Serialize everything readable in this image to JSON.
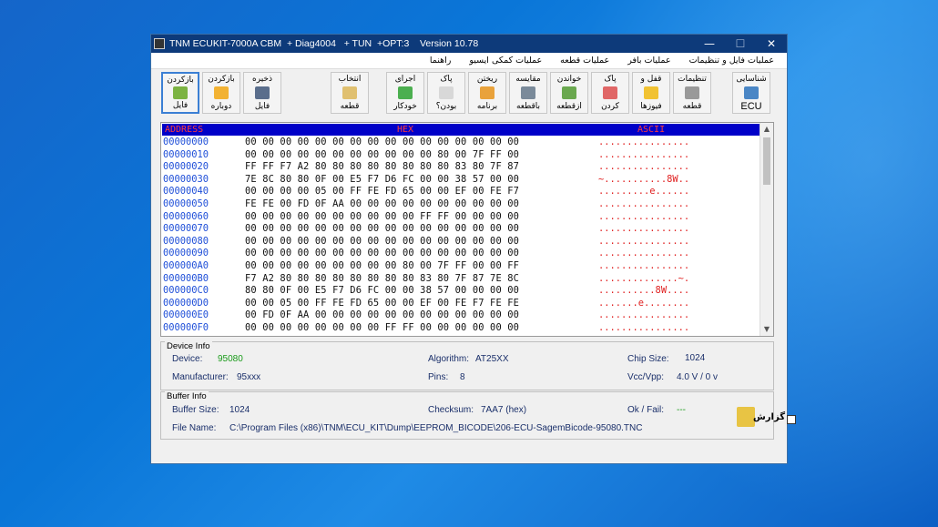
{
  "window": {
    "title": "TNM ECUKIT-7000A CBM  + Diag4004   + TUN  +OPT:3    Version 10.78",
    "controls": {
      "minimize": "—",
      "maximize": "☐",
      "close": "✕"
    }
  },
  "menu": [
    "عملیات فایل و تنظیمات",
    "عملیات بافر",
    "عملیات قطعه",
    "عملیات کمکی ایسیو",
    "راهنما"
  ],
  "toolbar": {
    "load_file": {
      "line1": "بازکردن",
      "line2": "فایل"
    },
    "reopen": {
      "line1": "بازکردن",
      "line2": "دوباره"
    },
    "save_file": {
      "line1": "ذخیره",
      "line2": "فایل"
    },
    "select_chip": {
      "line1": "انتخاب",
      "line2": "قطعه"
    },
    "auto_run": {
      "line1": "اجرای",
      "line2": "خودکار"
    },
    "blank_check": {
      "line1": "پاک",
      "line2": "بودن؟"
    },
    "program": {
      "line1": "ریختن",
      "line2": "برنامه"
    },
    "compare": {
      "line1": "مقایسه",
      "line2": "باقطعه"
    },
    "read": {
      "line1": "خواندن",
      "line2": "ازقطعه"
    },
    "erase": {
      "line1": "پاک",
      "line2": "کردن"
    },
    "fuses": {
      "line1": "قفل و",
      "line2": "فیوزها"
    },
    "chip_settings": {
      "line1": "تنظیمات",
      "line2": "قطعه"
    },
    "ecu_id": {
      "line1": "شناسایی",
      "line2": "ECU"
    }
  },
  "hex": {
    "header_address": "ADDRESS",
    "header_hex": "HEX",
    "header_ascii": "ASCII",
    "rows": [
      {
        "addr": "00000000",
        "bytes": "00 00 00 00 00 00 00 00 00 00 00 00 00 00 00 00",
        "ascii": "................"
      },
      {
        "addr": "00000010",
        "bytes": "00 00 00 00 00 00 00 00 00 00 00 80 00 7F FF 00",
        "ascii": "................"
      },
      {
        "addr": "00000020",
        "bytes": "FF FF F7 A2 80 80 80 80 80 80 80 80 83 80 7F 87",
        "ascii": "................"
      },
      {
        "addr": "00000030",
        "bytes": "7E 8C 80 80 0F 00 E5 F7 D6 FC 00 00 38 57 00 00",
        "ascii": "~...........8W.."
      },
      {
        "addr": "00000040",
        "bytes": "00 00 00 00 05 00 FF FE FD 65 00 00 EF 00 FE F7",
        "ascii": ".........e......"
      },
      {
        "addr": "00000050",
        "bytes": "FE FE 00 FD 0F AA 00 00 00 00 00 00 00 00 00 00",
        "ascii": "................"
      },
      {
        "addr": "00000060",
        "bytes": "00 00 00 00 00 00 00 00 00 00 FF FF 00 00 00 00",
        "ascii": "................"
      },
      {
        "addr": "00000070",
        "bytes": "00 00 00 00 00 00 00 00 00 00 00 00 00 00 00 00",
        "ascii": "................"
      },
      {
        "addr": "00000080",
        "bytes": "00 00 00 00 00 00 00 00 00 00 00 00 00 00 00 00",
        "ascii": "................"
      },
      {
        "addr": "00000090",
        "bytes": "00 00 00 00 00 00 00 00 00 00 00 00 00 00 00 00",
        "ascii": "................"
      },
      {
        "addr": "000000A0",
        "bytes": "00 00 00 00 00 00 00 00 00 80 00 7F FF 00 00 FF",
        "ascii": "................"
      },
      {
        "addr": "000000B0",
        "bytes": "F7 A2 80 80 80 80 80 80 80 80 83 80 7F 87 7E 8C",
        "ascii": "..............~."
      },
      {
        "addr": "000000C0",
        "bytes": "80 80 0F 00 E5 F7 D6 FC 00 00 38 57 00 00 00 00",
        "ascii": "..........8W...."
      },
      {
        "addr": "000000D0",
        "bytes": "00 00 05 00 FF FE FD 65 00 00 EF 00 FE F7 FE FE",
        "ascii": ".......e........"
      },
      {
        "addr": "000000E0",
        "bytes": "00 FD 0F AA 00 00 00 00 00 00 00 00 00 00 00 00",
        "ascii": "................"
      },
      {
        "addr": "000000F0",
        "bytes": "00 00 00 00 00 00 00 00 FF FF 00 00 00 00 00 00",
        "ascii": "................"
      }
    ]
  },
  "device_info": {
    "title": "Device Info",
    "device_label": "Device:",
    "device": "95080",
    "algorithm_label": "Algorithm:",
    "algorithm": "AT25XX",
    "chip_size_label": "Chip Size:",
    "chip_size": "1024",
    "manufacturer_label": "Manufacturer:",
    "manufacturer": "95xxx",
    "pins_label": "Pins:",
    "pins": "8",
    "vcc_label": "Vcc/Vpp:",
    "vcc": "4.0 V / 0 v"
  },
  "buffer_info": {
    "title": "Buffer Info",
    "buffer_size_label": "Buffer Size:",
    "buffer_size": "1024",
    "checksum_label": "Checksum:",
    "checksum": "7AA7 (hex)",
    "okfail_label": "Ok / Fail:",
    "okfail": "---",
    "filename_label": "File Name:",
    "filename": "C:\\Program Files (x86)\\TNM\\ECU_KIT\\Dump\\EEPROM_BICODE\\206-ECU-SagemBicode-95080.TNC",
    "report_label": "گزارش"
  },
  "colors": {
    "title_bar": "#0d3a7a",
    "hex_header_bg": "#0000c8",
    "address": "#1f4fd8",
    "ascii": "#e02020"
  }
}
